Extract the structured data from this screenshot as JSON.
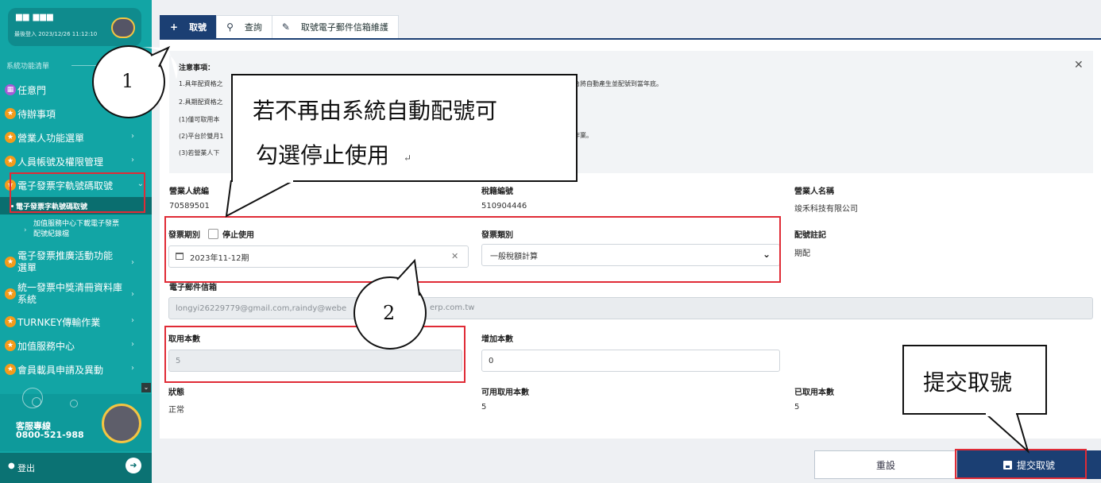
{
  "sidebar": {
    "user_name": "▆▆ ▆▆▆",
    "last_login": "最後登入 2023/12/26 11:12:10",
    "menu_title": "系統功能清單",
    "items": [
      {
        "label": "任意門",
        "icon": "door-icon"
      },
      {
        "label": "待辦事項",
        "icon": "star-icon"
      },
      {
        "label": "營業人功能選單",
        "icon": "star-icon"
      },
      {
        "label": "人員帳號及權限管理",
        "icon": "star-icon"
      },
      {
        "label": "電子發票字軌號碼取號",
        "icon": "star-icon"
      }
    ],
    "sub_active": "電子發票字軌號碼取號",
    "sub_item_line1": "加值服務中心下載電子發票",
    "sub_item_line2": "配號紀錄檔",
    "items2": [
      {
        "label1": "電子發票推廣活動功能",
        "label2": "選單"
      },
      {
        "label1": "統一發票中獎清冊資料庫",
        "label2": "系統"
      }
    ],
    "items3": [
      {
        "label": "TURNKEY傳輸作業"
      },
      {
        "label": "加值服務中心"
      },
      {
        "label": "會員載具申請及異動"
      }
    ],
    "hotline_label": "客服專線",
    "hotline_number": "0800-521-988",
    "logout": "登出"
  },
  "tabs": [
    {
      "label": "取號",
      "icon": "+"
    },
    {
      "label": "查詢",
      "icon": "⚲"
    },
    {
      "label": "取號電子郵件信箱維護",
      "icon": "✎"
    }
  ],
  "notice": {
    "title": "注意事項：",
    "lines": [
      "1.具年配資格之",
      "2.具期配資格之",
      "(1)僅可取用本",
      "(2)平台於雙月1",
      "(3)若營業人下"
    ],
    "line1_tail": "台將自動產生並配號到當年底。",
    "line4_tail": "作業。"
  },
  "form": {
    "tax_id_label": "營業人統編",
    "tax_id": "70589501",
    "tax_reg_label": "稅籍編號",
    "tax_reg": "510904446",
    "company_label": "營業人名稱",
    "company": "竣禾科技有限公司",
    "period_label": "發票期別",
    "stop_use_label": "停止使用",
    "period_value": "2023年11-12期",
    "type_label": "發票類別",
    "type_value": "一般稅額計算",
    "note_label": "配號註記",
    "note_value": "期配",
    "email_label": "電子郵件信箱",
    "email_value_a": "longyi26229779@gmail.com,raindy@webe",
    "email_value_b": "erp.com.tw",
    "take_count_label": "取用本數",
    "take_count_value": "5",
    "add_count_label": "增加本數",
    "add_count_value": "0",
    "status_label": "狀態",
    "status_value": "正常",
    "available_label": "可用取用本數",
    "available_value": "5",
    "taken_label": "已取用本數",
    "taken_value": "5"
  },
  "buttons": {
    "reset": "重設",
    "submit": "提交取號"
  },
  "annotations": {
    "callout_line1": "若不再由系統自動配號可",
    "callout_line2": "勾選停止使用",
    "callout_mark": "↵",
    "bubble1": "1",
    "bubble2": "2",
    "submit_callout": "提交取號"
  },
  "colors": {
    "sidebar": "#12a5a5",
    "primary": "#1b3f73",
    "annotation_red": "#e02b36",
    "icon_orange": "#f49b1b"
  }
}
